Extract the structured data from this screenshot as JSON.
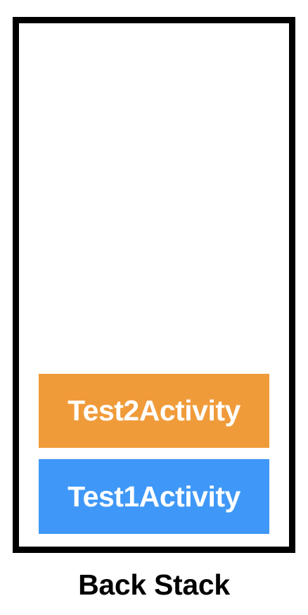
{
  "stack": {
    "items": [
      {
        "label": "Test2Activity",
        "color": "#f09b3a"
      },
      {
        "label": "Test1Activity",
        "color": "#3f98f7"
      }
    ]
  },
  "caption": "Back Stack"
}
